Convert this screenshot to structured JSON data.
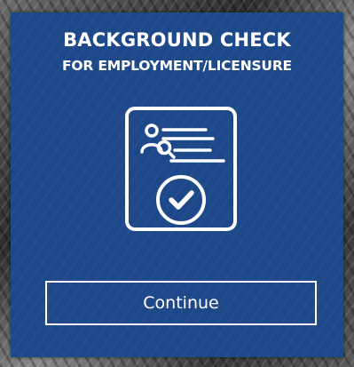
{
  "card": {
    "title": "BACKGROUND CHECK",
    "subtitle": "FOR EMPLOYMENT/LICENSURE",
    "icon": "document-person-check-icon",
    "continue_label": "Continue"
  },
  "colors": {
    "card_background": "#1d4889",
    "text": "#ffffff"
  }
}
